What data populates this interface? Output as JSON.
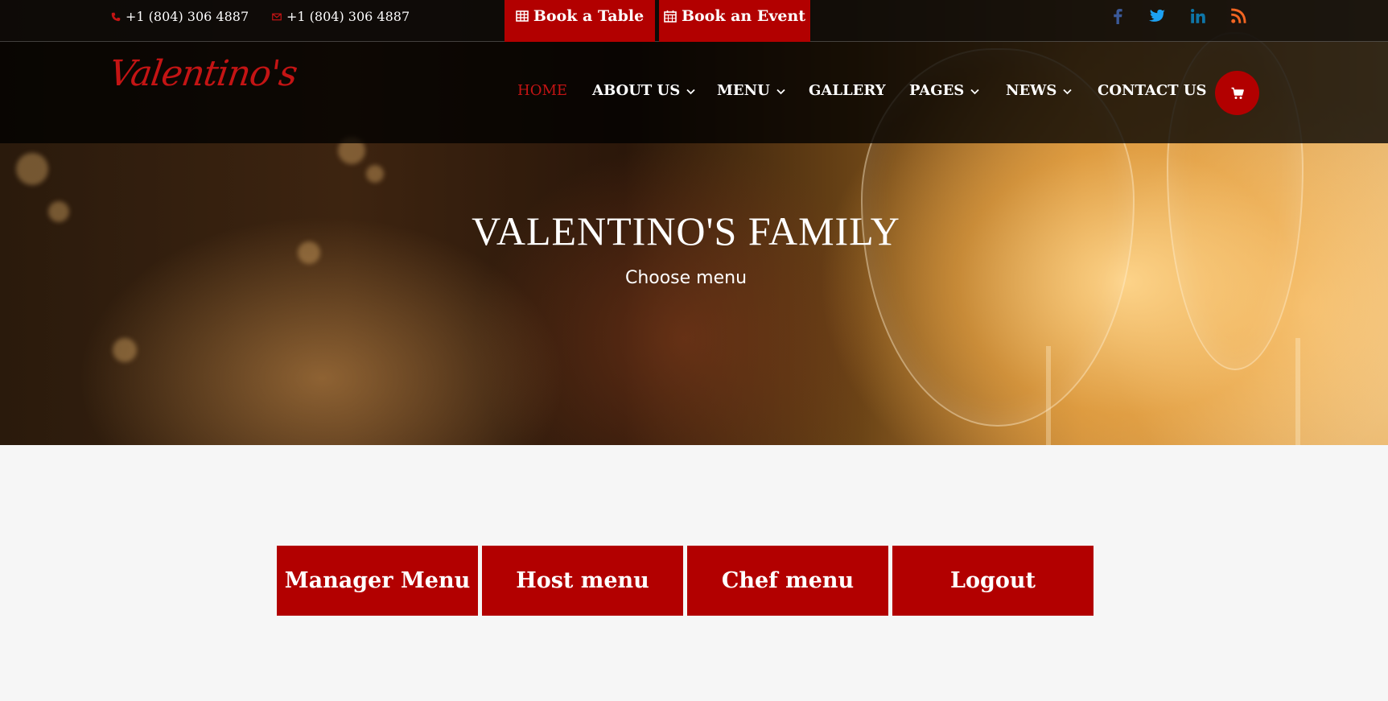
{
  "topbar": {
    "phone": "+1 (804) 306 4887",
    "email_phone": "+1 (804) 306 4887",
    "book_table": "Book a Table",
    "book_event": "Book an Event"
  },
  "social": [
    "facebook-icon",
    "twitter-icon",
    "linkedin-icon",
    "rss-icon"
  ],
  "brand": {
    "logo_text": "Valentino's",
    "accent_color": "#b20000"
  },
  "nav": {
    "items": [
      {
        "label": "HOME",
        "active": true,
        "dropdown": false
      },
      {
        "label": "ABOUT US",
        "active": false,
        "dropdown": true
      },
      {
        "label": "MENU",
        "active": false,
        "dropdown": true
      },
      {
        "label": "GALLERY",
        "active": false,
        "dropdown": false
      },
      {
        "label": "PAGES",
        "active": false,
        "dropdown": true
      },
      {
        "label": "NEWS",
        "active": false,
        "dropdown": true
      },
      {
        "label": "CONTACT US",
        "active": false,
        "dropdown": false
      }
    ]
  },
  "hero": {
    "title": "VALENTINO'S FAMILY",
    "subtitle": "Choose menu"
  },
  "menu_buttons": [
    "Manager Menu",
    "Host menu",
    "Chef menu",
    "Logout"
  ]
}
